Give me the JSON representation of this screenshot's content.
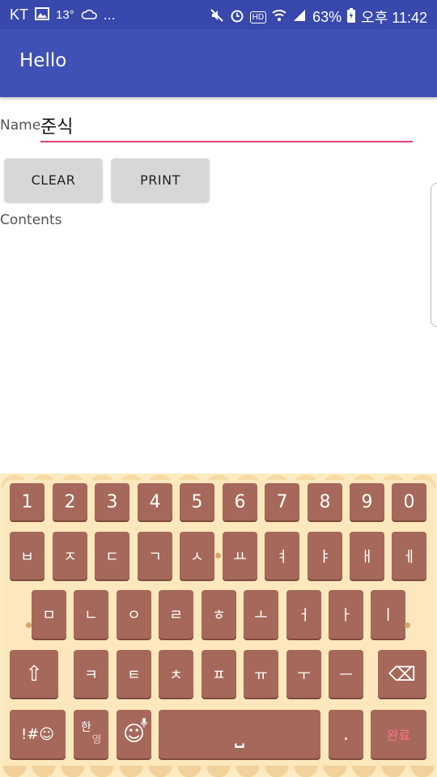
{
  "status_bar": {
    "carrier": "KT",
    "temperature": "13°",
    "more": "...",
    "hd_label": "HD",
    "battery": "63%",
    "time": "오후 11:42"
  },
  "app_bar": {
    "title": "Hello"
  },
  "form": {
    "name_label": "Name",
    "name_value": "준식",
    "clear_label": "CLEAR",
    "print_label": "PRINT",
    "contents_label": "Contents"
  },
  "keyboard": {
    "row1": [
      "1",
      "2",
      "3",
      "4",
      "5",
      "6",
      "7",
      "8",
      "9",
      "0"
    ],
    "row2": [
      "ㅂ",
      "ㅈ",
      "ㄷ",
      "ㄱ",
      "ㅅ",
      "ㅛ",
      "ㅕ",
      "ㅑ",
      "ㅐ",
      "ㅔ"
    ],
    "row3": [
      "ㅁ",
      "ㄴ",
      "ㅇ",
      "ㄹ",
      "ㅎ",
      "ㅗ",
      "ㅓ",
      "ㅏ",
      "ㅣ"
    ],
    "row4": [
      "ㅋ",
      "ㅌ",
      "ㅊ",
      "ㅍ",
      "ㅠ",
      "ㅜ",
      "ㅡ"
    ],
    "shift_icon": "⇧",
    "backspace_icon": "⌫",
    "symbols_label": "!#☺",
    "lang_top": "한",
    "lang_bottom": "영",
    "emoji_icon": "☺",
    "space_icon": "⎵",
    "period_label": ".",
    "done_label": "완료"
  }
}
